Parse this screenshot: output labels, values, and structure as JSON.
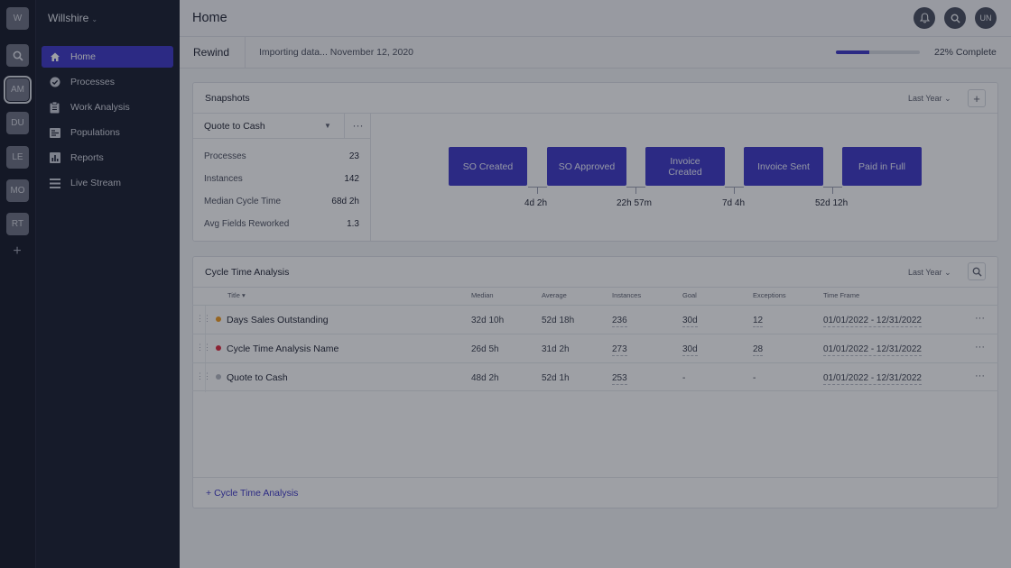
{
  "rail": {
    "org_initial": "W",
    "users": [
      "AM",
      "DU",
      "LE",
      "MO",
      "RT"
    ],
    "selected_user": "AM"
  },
  "sidebar": {
    "org_name": "Willshire",
    "items": [
      {
        "label": "Home",
        "icon": "home-icon",
        "active": true
      },
      {
        "label": "Processes",
        "icon": "processes-icon",
        "active": false
      },
      {
        "label": "Work Analysis",
        "icon": "clipboard-icon",
        "active": false
      },
      {
        "label": "Populations",
        "icon": "populations-icon",
        "active": false
      },
      {
        "label": "Reports",
        "icon": "bar-chart-icon",
        "active": false
      },
      {
        "label": "Live Stream",
        "icon": "list-icon",
        "active": false
      }
    ]
  },
  "header": {
    "title": "Home",
    "avatar": "UN"
  },
  "rewind": {
    "label": "Rewind",
    "status": "Importing data... November 12, 2020",
    "progress": 0.4,
    "progress_text": "22% Complete"
  },
  "snapshots": {
    "title": "Snapshots",
    "filter": "Last Year",
    "process": "Quote to Cash",
    "metrics": [
      {
        "label": "Processes",
        "value": "23"
      },
      {
        "label": "Instances",
        "value": "142"
      },
      {
        "label": "Median Cycle Time",
        "value": "68d 2h"
      },
      {
        "label": "Avg Fields Reworked",
        "value": "1.3"
      }
    ],
    "steps": [
      {
        "label": "SO Created"
      },
      {
        "label": "SO Approved"
      },
      {
        "label": "Invoice Created"
      },
      {
        "label": "Invoice Sent"
      },
      {
        "label": "Paid in Full"
      }
    ],
    "durations": [
      "4d 2h",
      "22h 57m",
      "7d 4h",
      "52d 12h"
    ]
  },
  "cycle": {
    "title": "Cycle Time Analysis",
    "filter": "Last Year",
    "columns": {
      "title": "Title",
      "median": "Median",
      "average": "Average",
      "instances": "Instances",
      "goal": "Goal",
      "exceptions": "Exceptions",
      "timeframe": "Time Frame"
    },
    "rows": [
      {
        "color": "#f29a1d",
        "title": "Days Sales Outstanding",
        "median": "32d 10h",
        "average": "52d 18h",
        "instances": "236",
        "goal": "30d",
        "exceptions": "12",
        "timeframe": "01/01/2022 - 12/31/2022"
      },
      {
        "color": "#e0263c",
        "title": "Cycle Time Analysis Name",
        "median": "26d 5h",
        "average": "31d 2h",
        "instances": "273",
        "goal": "30d",
        "exceptions": "28",
        "timeframe": "01/01/2022 - 12/31/2022"
      },
      {
        "color": "#b5b8c2",
        "title": "Quote to Cash",
        "median": "48d 2h",
        "average": "52d 1h",
        "instances": "253",
        "goal": "-",
        "exceptions": "-",
        "timeframe": "01/01/2022 - 12/31/2022"
      }
    ],
    "add_label": "Cycle Time Analysis"
  }
}
